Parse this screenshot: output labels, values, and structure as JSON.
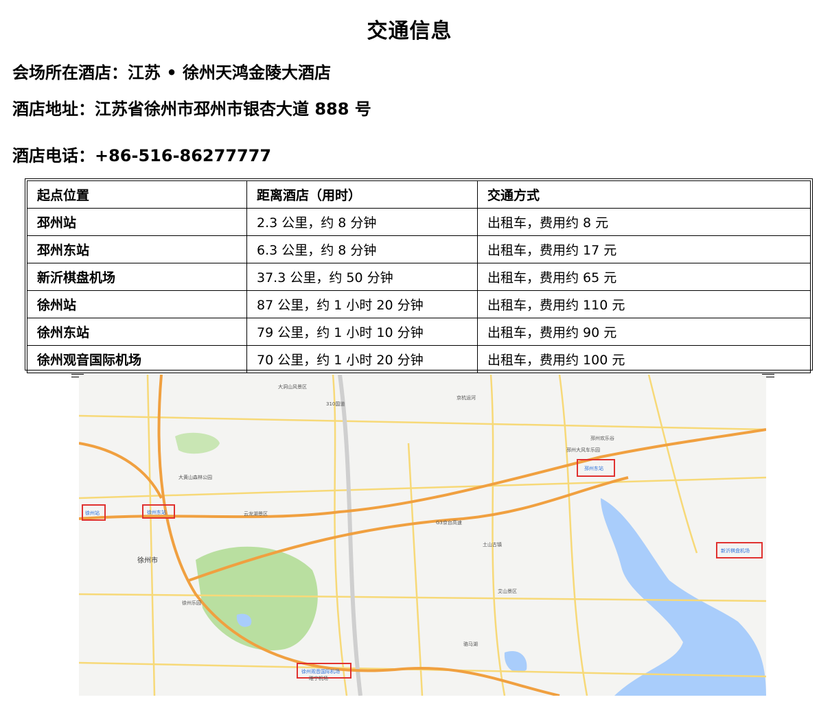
{
  "title": "交通信息",
  "venue": "会场所在酒店：江苏 • 徐州天鸿金陵大酒店",
  "address": "酒店地址：江苏省徐州市邳州市银杏大道 888 号",
  "phone": "酒店电话：+86-516-86277777",
  "table": {
    "headers": [
      "起点位置",
      "距离酒店（用时）",
      "交通方式"
    ],
    "rows": [
      [
        "邳州站",
        "2.3 公里，约 8 分钟",
        "出租车，费用约 8 元"
      ],
      [
        "邳州东站",
        "6.3 公里，约 8 分钟",
        "出租车，费用约 17 元"
      ],
      [
        "新沂棋盘机场",
        "37.3 公里，约 50 分钟",
        "出租车，费用约 65 元"
      ],
      [
        "徐州站",
        "87 公里，约 1 小时 20 分钟",
        "出租车，费用约 110 元"
      ],
      [
        "徐州东站",
        "79 公里，约 1 小时 10 分钟",
        "出租车，费用约 90 元"
      ],
      [
        "徐州观音国际机场",
        "70 公里，约 1 小时 20 分钟",
        "出租车，费用约 100 元"
      ]
    ]
  },
  "map": {
    "city_label": "徐州市",
    "highlighted": [
      "徐州站",
      "徐州东站",
      "邳州东站",
      "新沂棋盘机场",
      "徐州观音国际机场"
    ],
    "places": [
      "大洞山风景区",
      "大黄山森林公园",
      "云龙湖景区",
      "徐州乐园",
      "邳州欢乐谷",
      "邳州大风车乐园",
      "艾山景区",
      "土山古镇",
      "骆马湖",
      "睢宁机场"
    ],
    "roads": [
      "G3京台高速",
      "310国道",
      "京杭运河"
    ],
    "colors": {
      "highway": "#f0a040",
      "road": "#f7d978",
      "green": "#b9dfa0",
      "water": "#a9cdfb",
      "marker": "#e0312f"
    }
  }
}
